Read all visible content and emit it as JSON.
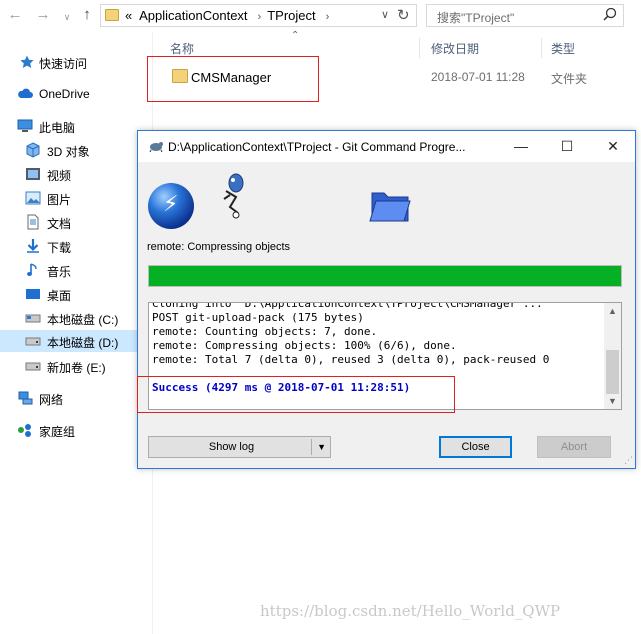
{
  "explorer": {
    "address": {
      "overflow": "«",
      "segments": [
        "ApplicationContext",
        "TProject"
      ]
    },
    "search_placeholder": "搜索\"TProject\"",
    "columns": {
      "name": "名称",
      "date": "修改日期",
      "type": "类型"
    },
    "files": [
      {
        "name": "CMSManager",
        "date": "2018-07-01 11:28",
        "type": "文件夹"
      }
    ]
  },
  "nav": {
    "items": [
      {
        "label": "快速访问",
        "icon": "star-icon"
      },
      {
        "label": "OneDrive",
        "icon": "cloud-icon"
      },
      {
        "label": "此电脑",
        "icon": "computer-icon"
      },
      {
        "label": "3D 对象",
        "icon": "cube-icon"
      },
      {
        "label": "视频",
        "icon": "video-icon"
      },
      {
        "label": "图片",
        "icon": "picture-icon"
      },
      {
        "label": "文档",
        "icon": "document-icon"
      },
      {
        "label": "下载",
        "icon": "download-icon"
      },
      {
        "label": "音乐",
        "icon": "music-icon"
      },
      {
        "label": "桌面",
        "icon": "desktop-icon"
      },
      {
        "label": "本地磁盘 (C:)",
        "icon": "drive-icon"
      },
      {
        "label": "本地磁盘 (D:)",
        "icon": "drive-icon",
        "selected": true
      },
      {
        "label": "新加卷 (E:)",
        "icon": "drive-icon"
      },
      {
        "label": "网络",
        "icon": "network-icon"
      },
      {
        "label": "家庭组",
        "icon": "homegroup-icon"
      }
    ]
  },
  "dialog": {
    "title": "D:\\ApplicationContext\\TProject - Git Command Progre...",
    "status": "remote: Compressing objects",
    "progress": 1.0,
    "log_cut": "Cloning into 'D:\\ApplicationContext\\TProject\\CMSManager'...",
    "log": [
      "POST git-upload-pack (175 bytes)",
      "remote: Counting objects: 7, done.",
      "remote: Compressing objects: 100% (6/6), done.",
      "remote: Total 7 (delta 0), reused 3 (delta 0), pack-reused 0"
    ],
    "success": "Success (4297 ms @ 2018-07-01 11:28:51)",
    "buttons": {
      "show_log": "Show log",
      "close": "Close",
      "abort": "Abort"
    }
  },
  "watermark": "https://blog.csdn.net/Hello_World_QWP",
  "colors": {
    "progress": "#06b025",
    "success_text": "#0000cc",
    "highlight_box": "#e02020",
    "selected_nav": "#cce8ff"
  }
}
